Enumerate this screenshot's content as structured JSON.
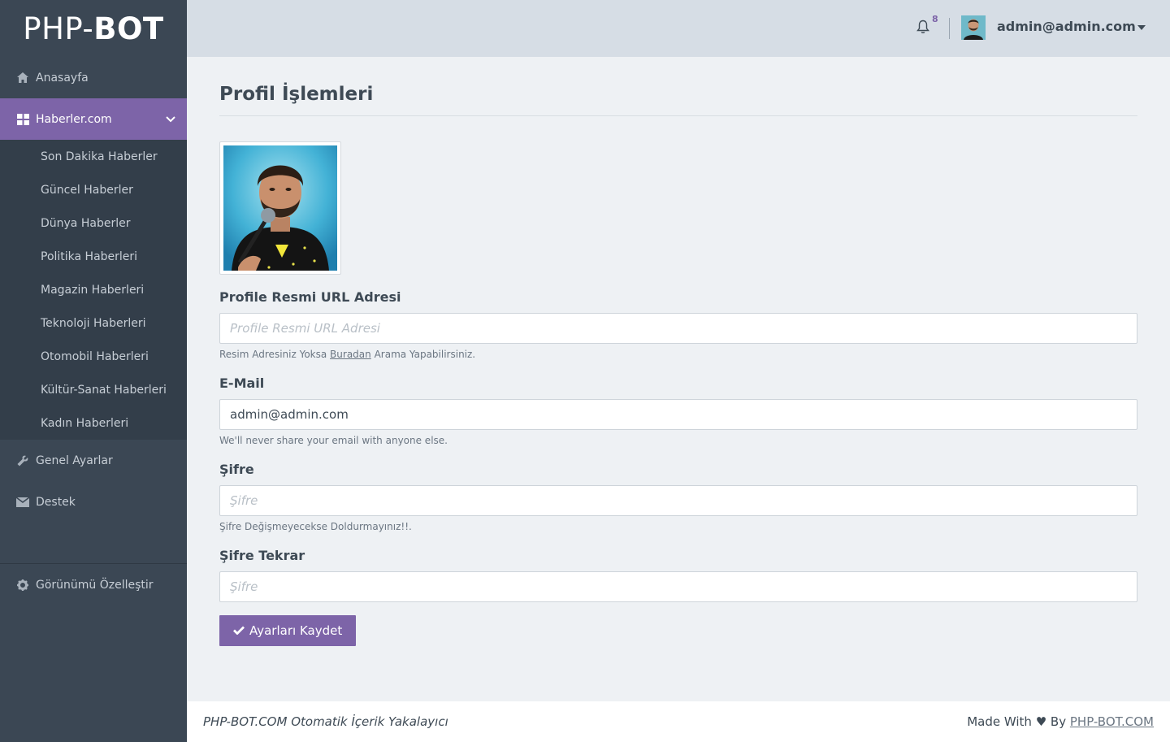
{
  "brand": {
    "logo_light": "PHP-",
    "logo_bold": "BOT"
  },
  "sidebar": {
    "items": [
      {
        "label": "Anasayfa",
        "icon": "home-icon"
      },
      {
        "label": "Haberler.com",
        "icon": "grid-icon"
      }
    ],
    "submenu": [
      "Son Dakika Haberler",
      "Güncel Haberler",
      "Dünya Haberler",
      "Politika Haberleri",
      "Magazin Haberleri",
      "Teknoloji Haberleri",
      "Otomobil Haberleri",
      "Kültür-Sanat Haberleri",
      "Kadın Haberleri"
    ],
    "settings_label": "Genel Ayarlar",
    "support_label": "Destek",
    "customize_label": "Görünümü Özelleştir"
  },
  "header": {
    "notification_count": "8",
    "user_email": "admin@admin.com"
  },
  "main": {
    "title": "Profil İşlemleri",
    "profile_url": {
      "label": "Profile Resmi URL Adresi",
      "placeholder": "Profile Resmi URL Adresi",
      "help_prefix": "Resim Adresiniz Yoksa",
      "help_link": "Buradan",
      "help_suffix": "Arama Yapabilirsiniz."
    },
    "email": {
      "label": "E-Mail",
      "value": "admin@admin.com",
      "help": "We'll never share your email with anyone else."
    },
    "password": {
      "label": "Şifre",
      "placeholder": "Şifre",
      "help": "Şifre Değişmeyecekse Doldurmayınız!!."
    },
    "password_repeat": {
      "label": "Şifre Tekrar",
      "placeholder": "Şifre"
    },
    "save_label": "Ayarları Kaydet"
  },
  "footer": {
    "left": "PHP-BOT.COM Otomatik İçerik Yakalayıcı",
    "right_prefix": "Made With ♥ By",
    "right_link": "PHP-BOT.COM"
  },
  "colors": {
    "accent": "#7d64a8",
    "sidebar": "#3b4754",
    "header": "#d6dde5"
  }
}
